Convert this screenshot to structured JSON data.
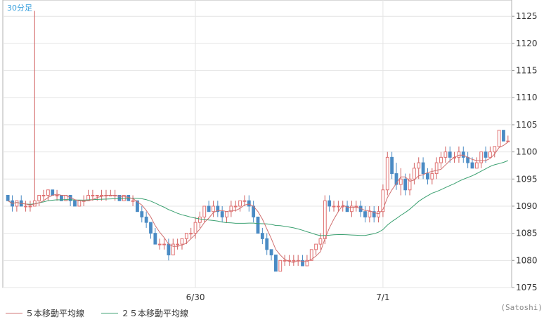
{
  "chart_data": {
    "type": "candlestick",
    "timeframe_label": "30分足",
    "ylim": [
      1075,
      1128
    ],
    "y_ticks": [
      1075,
      1080,
      1085,
      1090,
      1095,
      1100,
      1105,
      1110,
      1115,
      1120,
      1125
    ],
    "x_tick_labels": [
      {
        "label": "6/30",
        "index": 42
      },
      {
        "label": "7/1",
        "index": 84
      }
    ],
    "grid": true,
    "legend_position": "bottom-left",
    "up_color": "#e07070",
    "down_color": "#4a8bc4",
    "series": [
      {
        "name": "５本移動平均線",
        "color": "#d07070"
      },
      {
        "name": "２５本移動平均線",
        "color": "#3aa070"
      }
    ],
    "candles": [
      [
        1092,
        1092,
        1091,
        1091
      ],
      [
        1091,
        1092,
        1089,
        1090
      ],
      [
        1090,
        1091,
        1089,
        1091
      ],
      [
        1091,
        1092,
        1090,
        1090
      ],
      [
        1090,
        1091,
        1089,
        1090
      ],
      [
        1090,
        1091,
        1089,
        1090
      ],
      [
        1090,
        1126,
        1090,
        1091
      ],
      [
        1091,
        1092,
        1090,
        1092
      ],
      [
        1092,
        1093,
        1091,
        1092
      ],
      [
        1092,
        1093,
        1091,
        1093
      ],
      [
        1093,
        1093,
        1092,
        1092
      ],
      [
        1092,
        1093,
        1091,
        1092
      ],
      [
        1092,
        1092,
        1091,
        1091
      ],
      [
        1091,
        1092,
        1091,
        1092
      ],
      [
        1092,
        1092,
        1090,
        1091
      ],
      [
        1091,
        1091,
        1090,
        1090
      ],
      [
        1090,
        1091,
        1090,
        1091
      ],
      [
        1091,
        1092,
        1090,
        1091
      ],
      [
        1091,
        1093,
        1091,
        1092
      ],
      [
        1092,
        1093,
        1091,
        1092
      ],
      [
        1092,
        1092,
        1091,
        1092
      ],
      [
        1092,
        1093,
        1091,
        1092
      ],
      [
        1092,
        1093,
        1091,
        1092
      ],
      [
        1092,
        1093,
        1092,
        1092
      ],
      [
        1092,
        1093,
        1091,
        1092
      ],
      [
        1092,
        1092,
        1091,
        1091
      ],
      [
        1091,
        1092,
        1091,
        1092
      ],
      [
        1092,
        1092,
        1091,
        1091
      ],
      [
        1091,
        1092,
        1090,
        1091
      ],
      [
        1091,
        1091,
        1089,
        1089
      ],
      [
        1089,
        1090,
        1087,
        1088
      ],
      [
        1088,
        1089,
        1086,
        1087
      ],
      [
        1087,
        1087,
        1084,
        1085
      ],
      [
        1085,
        1086,
        1083,
        1083
      ],
      [
        1083,
        1084,
        1082,
        1083
      ],
      [
        1083,
        1084,
        1082,
        1083
      ],
      [
        1083,
        1084,
        1080,
        1081
      ],
      [
        1081,
        1084,
        1081,
        1083
      ],
      [
        1083,
        1084,
        1082,
        1083
      ],
      [
        1083,
        1084,
        1082,
        1084
      ],
      [
        1084,
        1085,
        1083,
        1085
      ],
      [
        1085,
        1086,
        1084,
        1085
      ],
      [
        1085,
        1088,
        1084,
        1087
      ],
      [
        1087,
        1089,
        1086,
        1088
      ],
      [
        1088,
        1090,
        1087,
        1090
      ],
      [
        1090,
        1091,
        1089,
        1089
      ],
      [
        1089,
        1091,
        1088,
        1090
      ],
      [
        1090,
        1091,
        1088,
        1089
      ],
      [
        1089,
        1090,
        1087,
        1088
      ],
      [
        1088,
        1089,
        1087,
        1089
      ],
      [
        1089,
        1091,
        1088,
        1090
      ],
      [
        1090,
        1091,
        1089,
        1090
      ],
      [
        1090,
        1091,
        1089,
        1091
      ],
      [
        1091,
        1092,
        1090,
        1091
      ],
      [
        1091,
        1092,
        1089,
        1090
      ],
      [
        1090,
        1091,
        1087,
        1088
      ],
      [
        1088,
        1088,
        1085,
        1085
      ],
      [
        1085,
        1086,
        1083,
        1084
      ],
      [
        1084,
        1085,
        1081,
        1082
      ],
      [
        1082,
        1082,
        1080,
        1081
      ],
      [
        1081,
        1081,
        1078,
        1078
      ],
      [
        1078,
        1080,
        1078,
        1080
      ],
      [
        1080,
        1081,
        1079,
        1080
      ],
      [
        1080,
        1081,
        1079,
        1080
      ],
      [
        1080,
        1081,
        1079,
        1080
      ],
      [
        1080,
        1081,
        1079,
        1080
      ],
      [
        1080,
        1081,
        1079,
        1079
      ],
      [
        1079,
        1081,
        1079,
        1080
      ],
      [
        1080,
        1082,
        1080,
        1082
      ],
      [
        1082,
        1083,
        1081,
        1083
      ],
      [
        1083,
        1085,
        1082,
        1084
      ],
      [
        1084,
        1092,
        1083,
        1091
      ],
      [
        1091,
        1092,
        1089,
        1090
      ],
      [
        1090,
        1091,
        1089,
        1090
      ],
      [
        1090,
        1091,
        1089,
        1090
      ],
      [
        1090,
        1091,
        1089,
        1090
      ],
      [
        1090,
        1091,
        1089,
        1089
      ],
      [
        1089,
        1091,
        1088,
        1090
      ],
      [
        1090,
        1091,
        1089,
        1090
      ],
      [
        1090,
        1091,
        1088,
        1089
      ],
      [
        1089,
        1090,
        1087,
        1088
      ],
      [
        1088,
        1090,
        1087,
        1089
      ],
      [
        1089,
        1090,
        1087,
        1088
      ],
      [
        1088,
        1090,
        1087,
        1089
      ],
      [
        1089,
        1094,
        1088,
        1093
      ],
      [
        1093,
        1100,
        1092,
        1099
      ],
      [
        1099,
        1100,
        1095,
        1096
      ],
      [
        1096,
        1098,
        1093,
        1094
      ],
      [
        1094,
        1097,
        1092,
        1095
      ],
      [
        1095,
        1096,
        1092,
        1093
      ],
      [
        1093,
        1096,
        1092,
        1095
      ],
      [
        1095,
        1098,
        1094,
        1097
      ],
      [
        1097,
        1099,
        1095,
        1098
      ],
      [
        1098,
        1099,
        1095,
        1096
      ],
      [
        1096,
        1097,
        1094,
        1095
      ],
      [
        1095,
        1097,
        1094,
        1096
      ],
      [
        1096,
        1099,
        1095,
        1098
      ],
      [
        1098,
        1100,
        1097,
        1099
      ],
      [
        1099,
        1101,
        1098,
        1100
      ],
      [
        1100,
        1101,
        1098,
        1099
      ],
      [
        1099,
        1100,
        1098,
        1099
      ],
      [
        1099,
        1101,
        1098,
        1100
      ],
      [
        1100,
        1101,
        1098,
        1099
      ],
      [
        1099,
        1100,
        1097,
        1098
      ],
      [
        1098,
        1099,
        1097,
        1097
      ],
      [
        1097,
        1099,
        1097,
        1098
      ],
      [
        1098,
        1100,
        1097,
        1100
      ],
      [
        1100,
        1101,
        1098,
        1099
      ],
      [
        1099,
        1101,
        1099,
        1100
      ],
      [
        1100,
        1101,
        1099,
        1101
      ],
      [
        1101,
        1104,
        1101,
        1104
      ],
      [
        1104,
        1104,
        1102,
        1102
      ],
      [
        1102,
        1103,
        1102,
        1102
      ]
    ]
  },
  "legend": {
    "ma5_label": "５本移動平均線",
    "ma25_label": "２５本移動平均線"
  },
  "credit": "(Satoshi)"
}
